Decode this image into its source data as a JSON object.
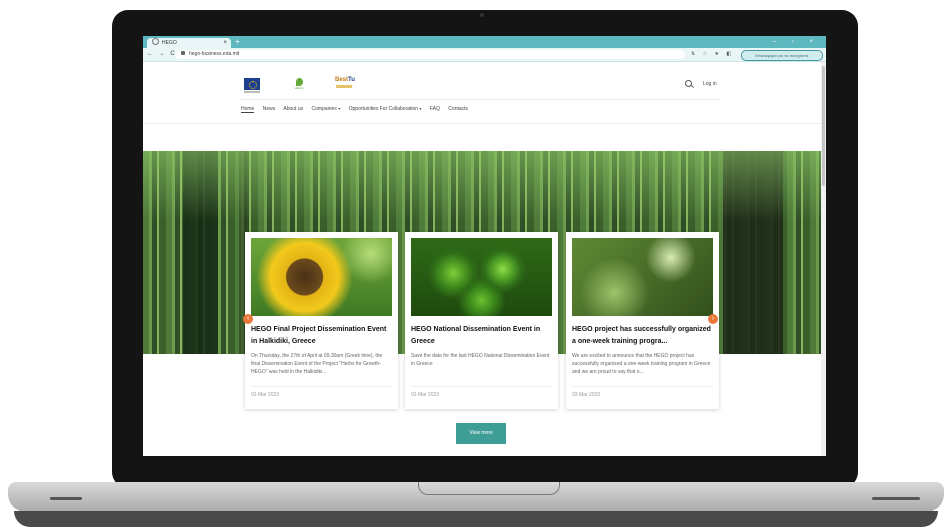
{
  "browser": {
    "tab_title": "HEGO",
    "tab_close": "×",
    "new_tab": "+",
    "window_controls": "– ▫ ×",
    "nav_buttons": "← → C",
    "url": "hego-business.eda.mit",
    "extensions": "⇅ ☆ ★ ◧",
    "profile": "Επαναφορά για να συνεχίσετε"
  },
  "site": {
    "logos": {
      "hego_word": "HEGO",
      "best_main": "Best",
      "best_accent": "Tu"
    },
    "login": "Log in",
    "menu": {
      "home": "Home",
      "news": "News",
      "about": "About us",
      "companies": "Companies",
      "opportunities": "Opportunities For Collaboration",
      "faq": "FAQ",
      "contacts": "Contacts",
      "caret": "▾"
    }
  },
  "cards": [
    {
      "title": "HEGO Final Project Dissemination Event in Halkidiki, Greece",
      "description": "On Thursday, the 27th of April at 09.30am (Greek time), the final Dissemination Event of the Project \"Herbs for Growth-HEGO\" was held in the Halkidiki...",
      "date": "03 Mar 2023",
      "image": "sunflower-image"
    },
    {
      "title": "HEGO National Dissemination Event in Greece",
      "description": "Save the date for the last HEGO National Dissemination Event in Greece",
      "date": "03 Mar 2023",
      "image": "fern-image"
    },
    {
      "title": "HEGO project has successfully organized a one-week training progra...",
      "description": "We are excited to announce that the HEGO project has successfully organized a one-week training program in Greece and we are proud to say that o...",
      "date": "03 Mar 2023",
      "image": "rain-leaves-image"
    }
  ],
  "carousel": {
    "prev": "‹",
    "next": "›"
  },
  "view_more": "View more",
  "colors": {
    "browser_accent": "#5db8bf",
    "button": "#3e9e96",
    "arrow": "#e9773a"
  }
}
